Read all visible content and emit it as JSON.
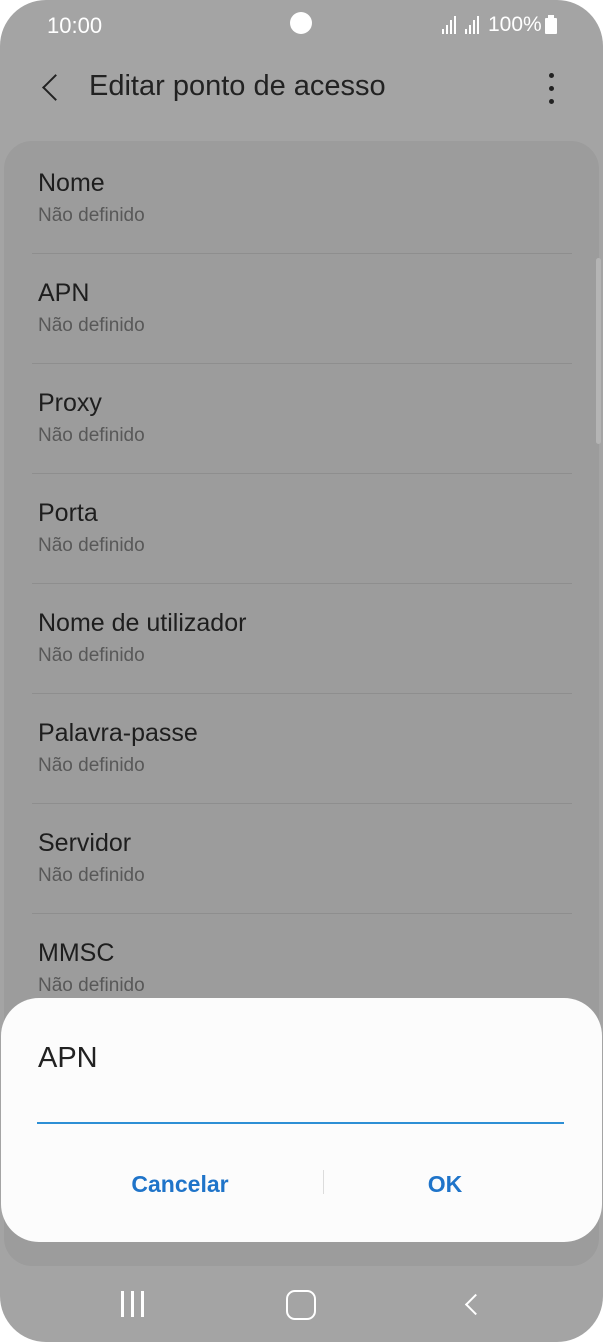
{
  "status_bar": {
    "time": "10:00",
    "battery": "100%",
    "icons": [
      "signal-icon",
      "signal-icon",
      "battery-icon"
    ]
  },
  "app_bar": {
    "title": "Editar ponto de acesso",
    "back_icon": "back-chevron-icon",
    "more_icon": "more-vertical-icon"
  },
  "settings": [
    {
      "label": "Nome",
      "value": "Não definido"
    },
    {
      "label": "APN",
      "value": "Não definido"
    },
    {
      "label": "Proxy",
      "value": "Não definido"
    },
    {
      "label": "Porta",
      "value": "Não definido"
    },
    {
      "label": "Nome de utilizador",
      "value": "Não definido"
    },
    {
      "label": "Palavra-passe",
      "value": "Não definido"
    },
    {
      "label": "Servidor",
      "value": "Não definido"
    },
    {
      "label": "MMSC",
      "value": "Não definido"
    }
  ],
  "dialog": {
    "title": "APN",
    "input_value": "",
    "cancel_label": "Cancelar",
    "ok_label": "OK"
  },
  "nav_bar": {
    "icons": [
      "recents-icon",
      "home-icon",
      "back-icon"
    ]
  },
  "colors": {
    "accent": "#1f74c9",
    "input_underline": "#2d8fd5",
    "dimmed_background": "#a4a4a4"
  }
}
